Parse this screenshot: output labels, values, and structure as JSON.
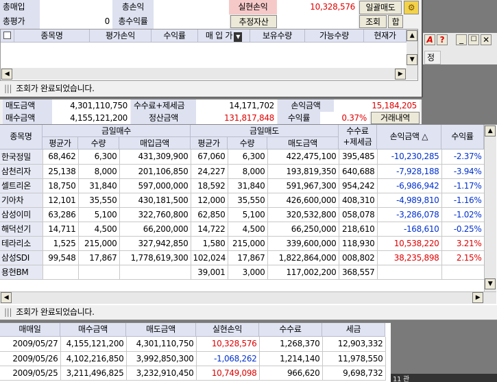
{
  "top_summary": {
    "total_buy_label": "총매입",
    "total_pl_label": "총손익",
    "realized_label": "실현손익",
    "realized_value": "10,328,576",
    "bulk_sell_button": "일괄매도",
    "total_eval_label": "총평가",
    "total_eval_value": "0",
    "total_return_label": "총수익률",
    "estimated_assets_button": "추정자산",
    "query_button": "조회",
    "sum_button": "합"
  },
  "holdings_headers": [
    "종목명",
    "평가손익",
    "수익률",
    "매 입 가",
    "보유수량",
    "가능수량",
    "현재가"
  ],
  "status_msg": "조회가 완료되었습니다.",
  "right_panel": {
    "a_icon": "A",
    "q_icon": "?",
    "label": "정"
  },
  "day_summary": {
    "sell_amount_label": "매도금액",
    "sell_amount": "4,301,110,750",
    "fee_tax_label": "수수료+제세금",
    "fee_tax": "14,171,702",
    "pl_amount_label": "손익금액",
    "pl_amount": "15,184,205",
    "buy_amount_label": "매수금액",
    "buy_amount": "4,155,121,200",
    "settle_label": "정산금액",
    "settle_amount": "131,817,848",
    "return_label": "수익률",
    "return_value": "0.37%",
    "history_button": "거래내역"
  },
  "trade_table": {
    "group_buy": "금일매수",
    "group_sell": "금일매도",
    "name_header": "종목명",
    "fee_header_1": "수수료",
    "fee_header_2": "+제세금",
    "pl_header": "손익금액 △",
    "ret_header": "수익률",
    "sub_headers": [
      "평균가",
      "수량",
      "매입금액",
      "평균가",
      "수량",
      "매도금액"
    ],
    "rows": [
      {
        "name": "한국정밀",
        "bavg": "68,462",
        "bqty": "6,300",
        "bamt": "431,309,900",
        "savg": "67,060",
        "sqty": "6,300",
        "samt": "422,475,100",
        "fee": "395,485",
        "pl": "-10,230,285",
        "ret": "-2.37%",
        "sign": "neg"
      },
      {
        "name": "삼천리자",
        "bavg": "25,138",
        "bqty": "8,000",
        "bamt": "201,106,850",
        "savg": "24,227",
        "sqty": "8,000",
        "samt": "193,819,350",
        "fee": "640,688",
        "pl": "-7,928,188",
        "ret": "-3.94%",
        "sign": "neg"
      },
      {
        "name": "셀트리온",
        "bavg": "18,750",
        "bqty": "31,840",
        "bamt": "597,000,000",
        "savg": "18,592",
        "sqty": "31,840",
        "samt": "591,967,300",
        "fee": "954,242",
        "pl": "-6,986,942",
        "ret": "-1.17%",
        "sign": "neg"
      },
      {
        "name": "기아차",
        "bavg": "12,101",
        "bqty": "35,550",
        "bamt": "430,181,500",
        "savg": "12,000",
        "sqty": "35,550",
        "samt": "426,600,000",
        "fee": "408,310",
        "pl": "-4,989,810",
        "ret": "-1.16%",
        "sign": "neg"
      },
      {
        "name": "삼성이미",
        "bavg": "63,286",
        "bqty": "5,100",
        "bamt": "322,760,800",
        "savg": "62,850",
        "sqty": "5,100",
        "samt": "320,532,800",
        "fee": "058,078",
        "pl": "-3,286,078",
        "ret": "-1.02%",
        "sign": "neg"
      },
      {
        "name": "해덕선기",
        "bavg": "14,711",
        "bqty": "4,500",
        "bamt": "66,200,000",
        "savg": "14,722",
        "sqty": "4,500",
        "samt": "66,250,000",
        "fee": "218,610",
        "pl": "-168,610",
        "ret": "-0.25%",
        "sign": "neg"
      },
      {
        "name": "테라리소",
        "bavg": "1,525",
        "bqty": "215,000",
        "bamt": "327,942,850",
        "savg": "1,580",
        "sqty": "215,000",
        "samt": "339,600,000",
        "fee": "118,930",
        "pl": "10,538,220",
        "ret": "3.21%",
        "sign": "pos"
      },
      {
        "name": "삼성SDI",
        "bavg": "99,548",
        "bqty": "17,867",
        "bamt": "1,778,619,300",
        "savg": "102,024",
        "sqty": "17,867",
        "samt": "1,822,864,000",
        "fee": "008,802",
        "pl": "38,235,898",
        "ret": "2.15%",
        "sign": "pos"
      },
      {
        "name": "용현BM",
        "bavg": "",
        "bqty": "",
        "bamt": "",
        "savg": "39,001",
        "sqty": "3,000",
        "samt": "117,002,200",
        "fee": "368,557",
        "pl": "",
        "ret": "",
        "sign": "none"
      }
    ]
  },
  "history_table": {
    "headers": [
      "매매일",
      "매수금액",
      "매도금액",
      "실현손익",
      "수수료",
      "세금"
    ],
    "rows": [
      {
        "date": "2009/05/27",
        "buy": "4,155,121,200",
        "sell": "4,301,110,750",
        "pl": "10,328,576",
        "fee": "1,268,370",
        "tax": "12,903,332",
        "sign": "pos"
      },
      {
        "date": "2009/05/26",
        "buy": "4,102,216,850",
        "sell": "3,992,850,300",
        "pl": "-1,068,262",
        "fee": "1,214,140",
        "tax": "11,978,550",
        "sign": "neg"
      },
      {
        "date": "2009/05/25",
        "buy": "3,211,496,825",
        "sell": "3,232,910,450",
        "pl": "10,749,098",
        "fee": "966,620",
        "tax": "9,698,732",
        "sign": "pos"
      }
    ]
  },
  "corner_fragment": "11 관"
}
